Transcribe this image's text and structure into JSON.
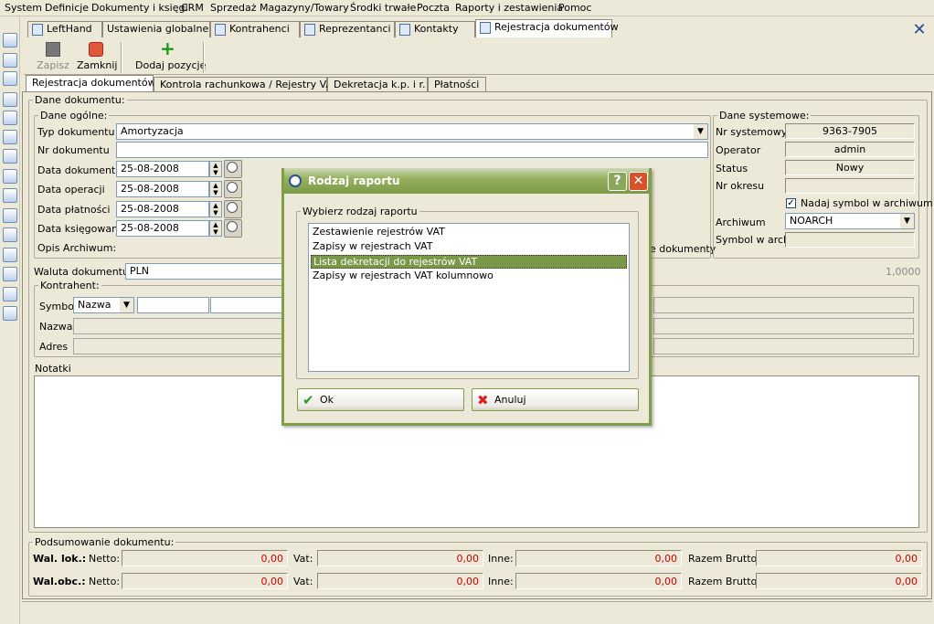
{
  "menu": [
    "System",
    "Definicje",
    "Dokumenty i księgi",
    "CRM",
    "Sprzedaż",
    "Magazyny/Towary",
    "Środki trwałe",
    "Poczta",
    "Raporty i zestawienia",
    "Pomoc"
  ],
  "doc_tabs": [
    "LeftHand",
    "Ustawienia globalne",
    "Kontrahenci",
    "Reprezentanci",
    "Kontakty",
    "Rejestracja dokumentów"
  ],
  "toolbar": {
    "save": "Zapisz",
    "close": "Zamknij",
    "add": "Dodaj pozycję"
  },
  "sub_tabs": [
    "Rejestracja dokumentów",
    "Kontrola rachunkowa / Rejestry VAT",
    "Dekretacja k.p. i r.",
    "Płatności"
  ],
  "dane_dokumentu": {
    "legend": "Dane dokumentu:",
    "ogolne_legend": "Dane ogólne:",
    "typ_label": "Typ dokumentu",
    "typ_value": "Amortyzacja",
    "nr_label": "Nr dokumentu",
    "nr_value": "",
    "data_dok_label": "Data dokumentu",
    "data_dok": "25-08-2008",
    "data_op_label": "Data operacji",
    "data_op": "25-08-2008",
    "data_plat_label": "Data płatności",
    "data_plat": "25-08-2008",
    "data_ksieg_label": "Data księgowania",
    "data_ksieg": "25-08-2008",
    "opis_label": "Opis Archiwum:",
    "opis_suffix": "e dokumenty"
  },
  "systemowe": {
    "legend": "Dane systemowe:",
    "nr_sys_label": "Nr systemowy",
    "nr_sys": "9363-7905",
    "operator_label": "Operator",
    "operator": "admin",
    "status_label": "Status",
    "status": "Nowy",
    "okres_label": "Nr okresu",
    "okres": "",
    "symbol_check_label": "Nadaj symbol w archiwum",
    "archiwum_label": "Archiwum",
    "archiwum": "NOARCH",
    "symbol_arch_label": "Symbol w arch"
  },
  "waluta": {
    "label": "Waluta dokumentu:",
    "value": "PLN",
    "rate": "1,0000"
  },
  "kontrahent": {
    "legend": "Kontrahent:",
    "symbol_label": "Symbol",
    "symbol_select": "Nazwa",
    "nazwa_label": "Nazwa",
    "adres_label": "Adres"
  },
  "notatki_label": "Notatki",
  "podsumowanie": {
    "legend": "Podsumowanie dokumentu:",
    "rows": [
      {
        "label": "Wal. lok.:",
        "netto_label": "Netto:",
        "netto": "0,00",
        "vat_label": "Vat:",
        "vat": "0,00",
        "inne_label": "Inne:",
        "inne": "0,00",
        "brutto_label": "Razem Brutto:",
        "brutto": "0,00"
      },
      {
        "label": "Wal.obc.:",
        "netto_label": "Netto:",
        "netto": "0,00",
        "vat_label": "Vat:",
        "vat": "0,00",
        "inne_label": "Inne:",
        "inne": "0,00",
        "brutto_label": "Razem Brutto:",
        "brutto": "0,00"
      }
    ]
  },
  "dialog": {
    "title": "Rodzaj raportu",
    "group_legend": "Wybierz rodzaj raportu",
    "options": [
      "Zestawienie rejestrów VAT",
      "Zapisy w rejestrach VAT",
      "Lista dekretacji do rejestrów VAT",
      "Zapisy w rejestrach VAT kolumnowo"
    ],
    "selected_index": 2,
    "ok": "Ok",
    "cancel": "Anuluj",
    "help_glyph": "?",
    "close_glyph": "✕"
  },
  "colors": {
    "window_bg": "#ece9d8",
    "dialog_frame": "#7a9948",
    "selection": "#7a9948",
    "amount_red": "#cc0000"
  }
}
